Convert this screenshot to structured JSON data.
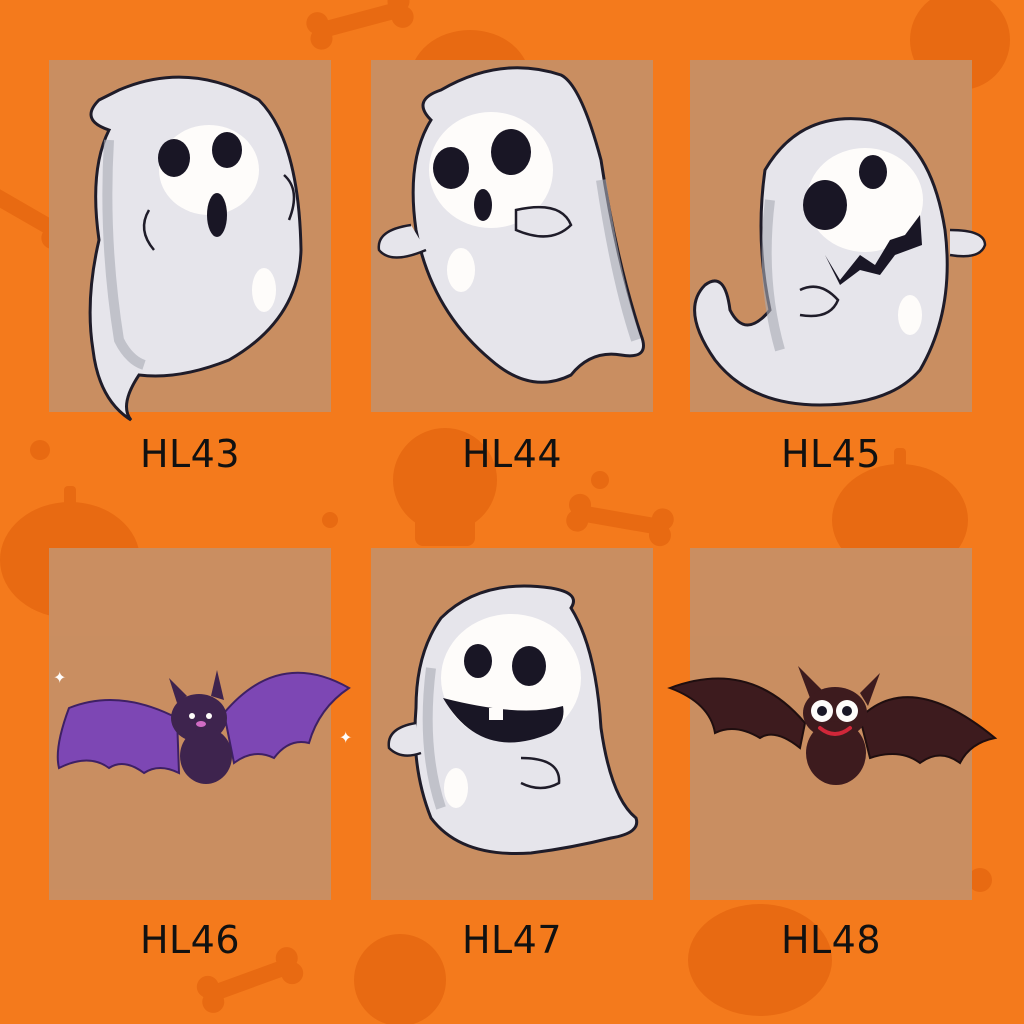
{
  "colors": {
    "background": "#f47a1c",
    "pattern": "#e86a12",
    "card": "#c98f63",
    "ghost_body": "#e6e8f0",
    "ghost_shadow": "#a9acb8",
    "purple_bat": "#7b47b8",
    "dark_bat": "#3a1a1f"
  },
  "items": [
    {
      "code": "HL43",
      "icon": "ghost-surprised-icon"
    },
    {
      "code": "HL44",
      "icon": "ghost-skull-icon"
    },
    {
      "code": "HL45",
      "icon": "ghost-jagged-grin-icon"
    },
    {
      "code": "HL46",
      "icon": "purple-bat-icon"
    },
    {
      "code": "HL47",
      "icon": "ghost-happy-icon"
    },
    {
      "code": "HL48",
      "icon": "dark-bat-icon"
    }
  ]
}
